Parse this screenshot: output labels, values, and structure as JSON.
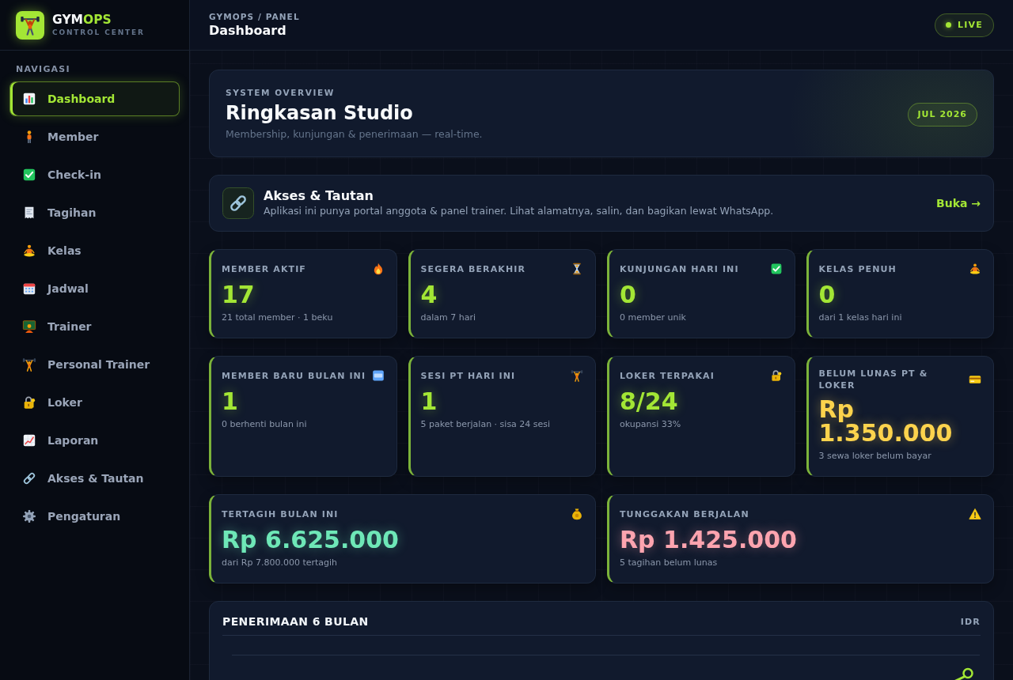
{
  "brand": {
    "name": "GYM",
    "name_accent": "OPS",
    "tagline": "CONTROL CENTER"
  },
  "sidebar": {
    "heading": "NAVIGASI",
    "items": [
      {
        "label": "Dashboard",
        "selected": true
      },
      {
        "label": "Member",
        "selected": false
      },
      {
        "label": "Check-in",
        "selected": false
      },
      {
        "label": "Tagihan",
        "selected": false
      },
      {
        "label": "Kelas",
        "selected": false
      },
      {
        "label": "Jadwal",
        "selected": false
      },
      {
        "label": "Trainer",
        "selected": false
      },
      {
        "label": "Personal Trainer",
        "selected": false
      },
      {
        "label": "Loker",
        "selected": false
      },
      {
        "label": "Laporan",
        "selected": false
      },
      {
        "label": "Akses & Tautan",
        "selected": false
      },
      {
        "label": "Pengaturan",
        "selected": false
      }
    ]
  },
  "header": {
    "breadcrumb": "GYMOPS / PANEL",
    "title": "Dashboard",
    "status": "LIVE"
  },
  "overview": {
    "eyebrow": "SYSTEM OVERVIEW",
    "title": "Ringkasan Studio",
    "subtitle": "Membership, kunjungan & penerimaan — real-time.",
    "period": "JUL 2026"
  },
  "access": {
    "title": "Akses & Tautan",
    "description": "Aplikasi ini punya portal anggota & panel trainer. Lihat alamatnya, salin, dan bagikan lewat WhatsApp.",
    "action": "Buka →"
  },
  "stats": [
    {
      "label": "MEMBER AKTIF",
      "value": "17",
      "note": "21 total member · 1 beku",
      "color": "#a3e635"
    },
    {
      "label": "SEGERA BERAKHIR",
      "value": "4",
      "note": "dalam 7 hari",
      "color": "#a3e635"
    },
    {
      "label": "KUNJUNGAN HARI INI",
      "value": "0",
      "note": "0 member unik",
      "color": "#a3e635"
    },
    {
      "label": "KELAS PENUH",
      "value": "0",
      "note": "dari 1 kelas hari ini",
      "color": "#a3e635"
    },
    {
      "label": "MEMBER BARU BULAN INI",
      "value": "1",
      "note": "0 berhenti bulan ini",
      "color": "#a3e635"
    },
    {
      "label": "SESI PT HARI INI",
      "value": "1",
      "note": "5 paket berjalan · sisa 24 sesi",
      "color": "#a3e635"
    },
    {
      "label": "LOKER TERPAKAI",
      "value": "8/24",
      "note": "okupansi 33%",
      "color": "#a3e635"
    },
    {
      "label": "BELUM LUNAS PT & LOKER",
      "value": "Rp 1.350.000",
      "note": "3 sewa loker belum bayar",
      "color": "#fcd34d"
    }
  ],
  "totals": [
    {
      "label": "TERTAGIH BULAN INI",
      "value": "Rp 6.625.000",
      "note": "dari Rp 7.800.000 tertagih",
      "color": "#6ee7b7"
    },
    {
      "label": "TUNGGAKAN BERJALAN",
      "value": "Rp 1.425.000",
      "note": "5 tagihan belum lunas",
      "color": "#fda4af"
    }
  ],
  "chart_panel": {
    "title": "PENERIMAAN 6 BULAN",
    "unit": "IDR"
  }
}
